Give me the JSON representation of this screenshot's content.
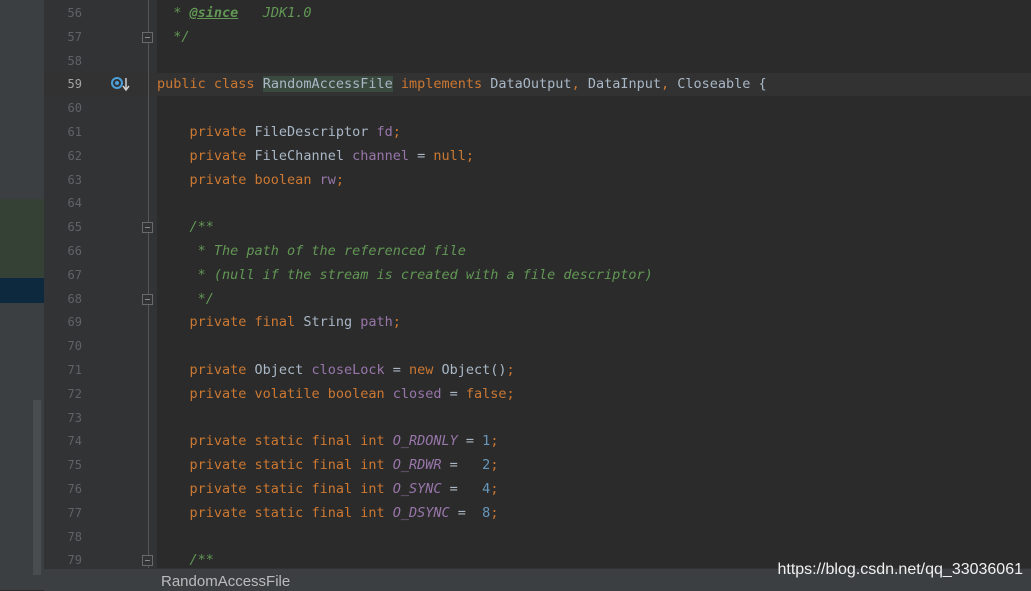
{
  "editor": {
    "current_line": 59,
    "lines": [
      {
        "n": 56,
        "tokens": [
          {
            "t": "  ",
            "c": ""
          },
          {
            "t": "* ",
            "c": "comment"
          },
          {
            "t": "@since",
            "c": "tag"
          },
          {
            "t": "   JDK1.0",
            "c": "comment"
          }
        ]
      },
      {
        "n": 57,
        "tokens": [
          {
            "t": "  ",
            "c": ""
          },
          {
            "t": "*/",
            "c": "comment"
          }
        ]
      },
      {
        "n": 58,
        "tokens": []
      },
      {
        "n": 59,
        "tokens": [
          {
            "t": "public ",
            "c": "kw"
          },
          {
            "t": "class ",
            "c": "kw"
          },
          {
            "t": "RandomAccessFile",
            "c": "hl-class"
          },
          {
            "t": " ",
            "c": ""
          },
          {
            "t": "implements ",
            "c": "kw"
          },
          {
            "t": "DataOutput",
            "c": ""
          },
          {
            "t": ", ",
            "c": "kw"
          },
          {
            "t": "DataInput",
            "c": ""
          },
          {
            "t": ", ",
            "c": "kw"
          },
          {
            "t": "Closeable {",
            "c": ""
          }
        ]
      },
      {
        "n": 60,
        "tokens": []
      },
      {
        "n": 61,
        "tokens": [
          {
            "t": "    ",
            "c": ""
          },
          {
            "t": "private ",
            "c": "kw"
          },
          {
            "t": "FileDescriptor ",
            "c": ""
          },
          {
            "t": "fd",
            "c": "field"
          },
          {
            "t": ";",
            "c": "kw"
          }
        ]
      },
      {
        "n": 62,
        "tokens": [
          {
            "t": "    ",
            "c": ""
          },
          {
            "t": "private ",
            "c": "kw"
          },
          {
            "t": "FileChannel ",
            "c": ""
          },
          {
            "t": "channel",
            "c": "field"
          },
          {
            "t": " = ",
            "c": ""
          },
          {
            "t": "null",
            "c": "kw"
          },
          {
            "t": ";",
            "c": "kw"
          }
        ]
      },
      {
        "n": 63,
        "tokens": [
          {
            "t": "    ",
            "c": ""
          },
          {
            "t": "private ",
            "c": "kw"
          },
          {
            "t": "boolean ",
            "c": "kw"
          },
          {
            "t": "rw",
            "c": "field"
          },
          {
            "t": ";",
            "c": "kw"
          }
        ]
      },
      {
        "n": 64,
        "tokens": []
      },
      {
        "n": 65,
        "tokens": [
          {
            "t": "    ",
            "c": ""
          },
          {
            "t": "/**",
            "c": "comment"
          }
        ]
      },
      {
        "n": 66,
        "tokens": [
          {
            "t": "     ",
            "c": ""
          },
          {
            "t": "* The path of the referenced file",
            "c": "comment"
          }
        ]
      },
      {
        "n": 67,
        "tokens": [
          {
            "t": "     ",
            "c": ""
          },
          {
            "t": "* (null if the stream is created with a file descriptor)",
            "c": "comment"
          }
        ]
      },
      {
        "n": 68,
        "tokens": [
          {
            "t": "     ",
            "c": ""
          },
          {
            "t": "*/",
            "c": "comment"
          }
        ]
      },
      {
        "n": 69,
        "tokens": [
          {
            "t": "    ",
            "c": ""
          },
          {
            "t": "private ",
            "c": "kw"
          },
          {
            "t": "final ",
            "c": "kw"
          },
          {
            "t": "String ",
            "c": ""
          },
          {
            "t": "path",
            "c": "field"
          },
          {
            "t": ";",
            "c": "kw"
          }
        ]
      },
      {
        "n": 70,
        "tokens": []
      },
      {
        "n": 71,
        "tokens": [
          {
            "t": "    ",
            "c": ""
          },
          {
            "t": "private ",
            "c": "kw"
          },
          {
            "t": "Object ",
            "c": ""
          },
          {
            "t": "closeLock",
            "c": "field"
          },
          {
            "t": " = ",
            "c": ""
          },
          {
            "t": "new ",
            "c": "kw"
          },
          {
            "t": "Object()",
            "c": ""
          },
          {
            "t": ";",
            "c": "kw"
          }
        ]
      },
      {
        "n": 72,
        "tokens": [
          {
            "t": "    ",
            "c": ""
          },
          {
            "t": "private ",
            "c": "kw"
          },
          {
            "t": "volatile ",
            "c": "kw"
          },
          {
            "t": "boolean ",
            "c": "kw"
          },
          {
            "t": "closed",
            "c": "field"
          },
          {
            "t": " = ",
            "c": ""
          },
          {
            "t": "false",
            "c": "kw"
          },
          {
            "t": ";",
            "c": "kw"
          }
        ]
      },
      {
        "n": 73,
        "tokens": []
      },
      {
        "n": 74,
        "tokens": [
          {
            "t": "    ",
            "c": ""
          },
          {
            "t": "private ",
            "c": "kw"
          },
          {
            "t": "static ",
            "c": "kw"
          },
          {
            "t": "final ",
            "c": "kw"
          },
          {
            "t": "int ",
            "c": "kw"
          },
          {
            "t": "O_RDONLY",
            "c": "const"
          },
          {
            "t": " = ",
            "c": ""
          },
          {
            "t": "1",
            "c": "num"
          },
          {
            "t": ";",
            "c": "kw"
          }
        ]
      },
      {
        "n": 75,
        "tokens": [
          {
            "t": "    ",
            "c": ""
          },
          {
            "t": "private ",
            "c": "kw"
          },
          {
            "t": "static ",
            "c": "kw"
          },
          {
            "t": "final ",
            "c": "kw"
          },
          {
            "t": "int ",
            "c": "kw"
          },
          {
            "t": "O_RDWR",
            "c": "const"
          },
          {
            "t": " =   ",
            "c": ""
          },
          {
            "t": "2",
            "c": "num"
          },
          {
            "t": ";",
            "c": "kw"
          }
        ]
      },
      {
        "n": 76,
        "tokens": [
          {
            "t": "    ",
            "c": ""
          },
          {
            "t": "private ",
            "c": "kw"
          },
          {
            "t": "static ",
            "c": "kw"
          },
          {
            "t": "final ",
            "c": "kw"
          },
          {
            "t": "int ",
            "c": "kw"
          },
          {
            "t": "O_SYNC",
            "c": "const"
          },
          {
            "t": " =   ",
            "c": ""
          },
          {
            "t": "4",
            "c": "num"
          },
          {
            "t": ";",
            "c": "kw"
          }
        ]
      },
      {
        "n": 77,
        "tokens": [
          {
            "t": "    ",
            "c": ""
          },
          {
            "t": "private ",
            "c": "kw"
          },
          {
            "t": "static ",
            "c": "kw"
          },
          {
            "t": "final ",
            "c": "kw"
          },
          {
            "t": "int ",
            "c": "kw"
          },
          {
            "t": "O_DSYNC",
            "c": "const"
          },
          {
            "t": " =  ",
            "c": ""
          },
          {
            "t": "8",
            "c": "num"
          },
          {
            "t": ";",
            "c": "kw"
          }
        ]
      },
      {
        "n": 78,
        "tokens": []
      },
      {
        "n": 79,
        "tokens": [
          {
            "t": "    ",
            "c": ""
          },
          {
            "t": "/**",
            "c": "comment"
          }
        ]
      }
    ],
    "fold_markers": [
      57,
      65,
      68,
      79
    ]
  },
  "gutter": {
    "override_icon": "implemented-override-icon"
  },
  "status": {
    "breadcrumb": "RandomAccessFile",
    "watermark": "https://blog.csdn.net/qq_33036061"
  }
}
